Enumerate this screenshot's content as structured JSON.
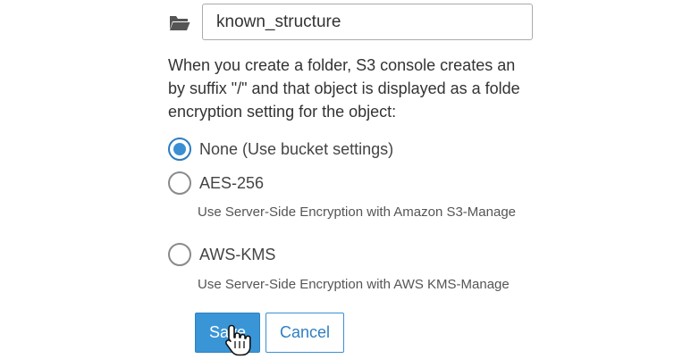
{
  "folder": {
    "icon": "folder-open-icon",
    "name_value": "known_structure"
  },
  "description": {
    "line1": "When you create a folder, S3 console creates an",
    "line2": "by suffix \"/\" and that object is displayed as a folde",
    "line3": "encryption setting for the object:"
  },
  "encryption_options": [
    {
      "label": "None (Use bucket settings)",
      "checked": true,
      "sub": ""
    },
    {
      "label": "AES-256",
      "checked": false,
      "sub": "Use Server-Side Encryption with Amazon S3-Manage"
    },
    {
      "label": "AWS-KMS",
      "checked": false,
      "sub": "Use Server-Side Encryption with AWS KMS-Manage"
    }
  ],
  "buttons": {
    "save_label": "Save",
    "cancel_label": "Cancel"
  },
  "colors": {
    "accent": "#3a95d6",
    "radio_selected": "#3a8fd4",
    "input_border": "#aaaaaa"
  }
}
